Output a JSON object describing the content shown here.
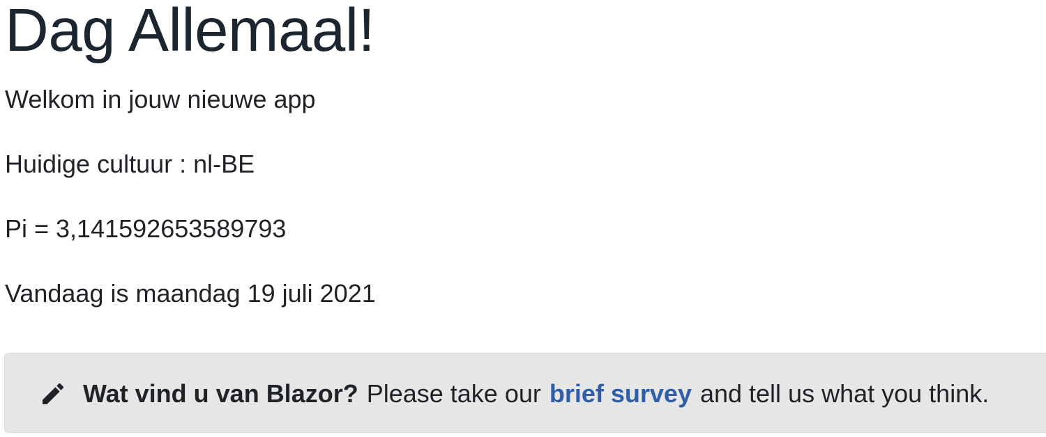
{
  "page": {
    "title": "Dag Allemaal!",
    "welcome": "Welkom in jouw nieuwe app",
    "culture": "Huidige cultuur : nl-BE",
    "pi": "Pi = 3,141592653589793",
    "today": "Vandaag is maandag 19 juli 2021"
  },
  "survey": {
    "icon": "pencil-icon",
    "title": "Wat vind u van Blazor?",
    "prefix": "Please take our",
    "link_label": "brief survey",
    "suffix": "and tell us what you think."
  },
  "colors": {
    "text": "#1f2327",
    "link": "#2f5ea8",
    "survey_bg": "#e6e6e6"
  }
}
